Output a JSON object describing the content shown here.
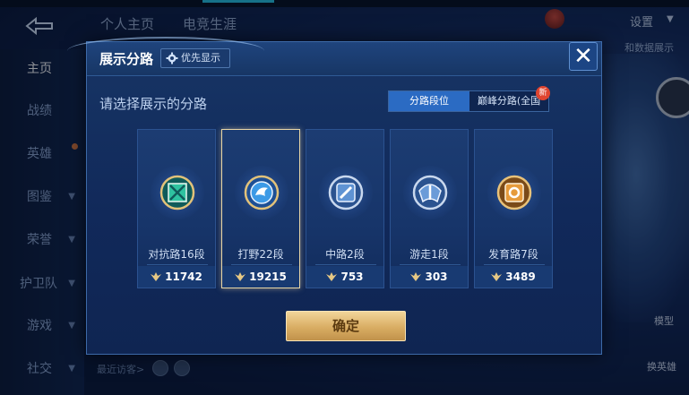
{
  "background": {
    "top_tabs": [
      "个人主页",
      "电竞生涯"
    ],
    "settings_label": "设置",
    "data_display_label": "和数据展示",
    "left_nav": [
      {
        "label": "主页",
        "active": true,
        "has_chevron": false,
        "has_dot": false
      },
      {
        "label": "战绩",
        "active": false,
        "has_chevron": false,
        "has_dot": false
      },
      {
        "label": "英雄",
        "active": false,
        "has_chevron": false,
        "has_dot": true
      },
      {
        "label": "图鉴",
        "active": false,
        "has_chevron": true,
        "has_dot": true
      },
      {
        "label": "荣誉",
        "active": false,
        "has_chevron": true,
        "has_dot": true
      },
      {
        "label": "护卫队",
        "active": false,
        "has_chevron": true,
        "has_dot": false
      },
      {
        "label": "游戏",
        "active": false,
        "has_chevron": true,
        "has_dot": false
      },
      {
        "label": "社交",
        "active": false,
        "has_chevron": true,
        "has_dot": true
      }
    ],
    "recent_visitors_label": "最近访客>",
    "model_label": "模型",
    "swap_hero_label": "换英雄"
  },
  "modal": {
    "title": "展示分路",
    "priority_badge": "优先显示",
    "close_glyph": "✕",
    "subtitle": "请选择展示的分路",
    "toggle": {
      "active_label": "分路段位",
      "inactive_label": "巅峰分路(全国",
      "new_badge": "新"
    },
    "cards": [
      {
        "label": "对抗路16段",
        "score": "11742",
        "icon": "clash-lane-emblem-icon",
        "color": "#2aa88a",
        "selected": false
      },
      {
        "label": "打野22段",
        "score": "19215",
        "icon": "jungle-emblem-icon",
        "color": "#2f86d6",
        "selected": true
      },
      {
        "label": "中路2段",
        "score": "753",
        "icon": "mid-lane-emblem-icon",
        "color": "#4f86c8",
        "selected": false
      },
      {
        "label": "游走1段",
        "score": "303",
        "icon": "roam-emblem-icon",
        "color": "#4f86c8",
        "selected": false
      },
      {
        "label": "发育路7段",
        "score": "3489",
        "icon": "farm-lane-emblem-icon",
        "color": "#d08a3a",
        "selected": false
      }
    ],
    "confirm_label": "确定"
  },
  "colors": {
    "accent_blue": "#2b6bc3",
    "gold_button": "#d9ad63",
    "new_badge_red": "#e0442f"
  }
}
